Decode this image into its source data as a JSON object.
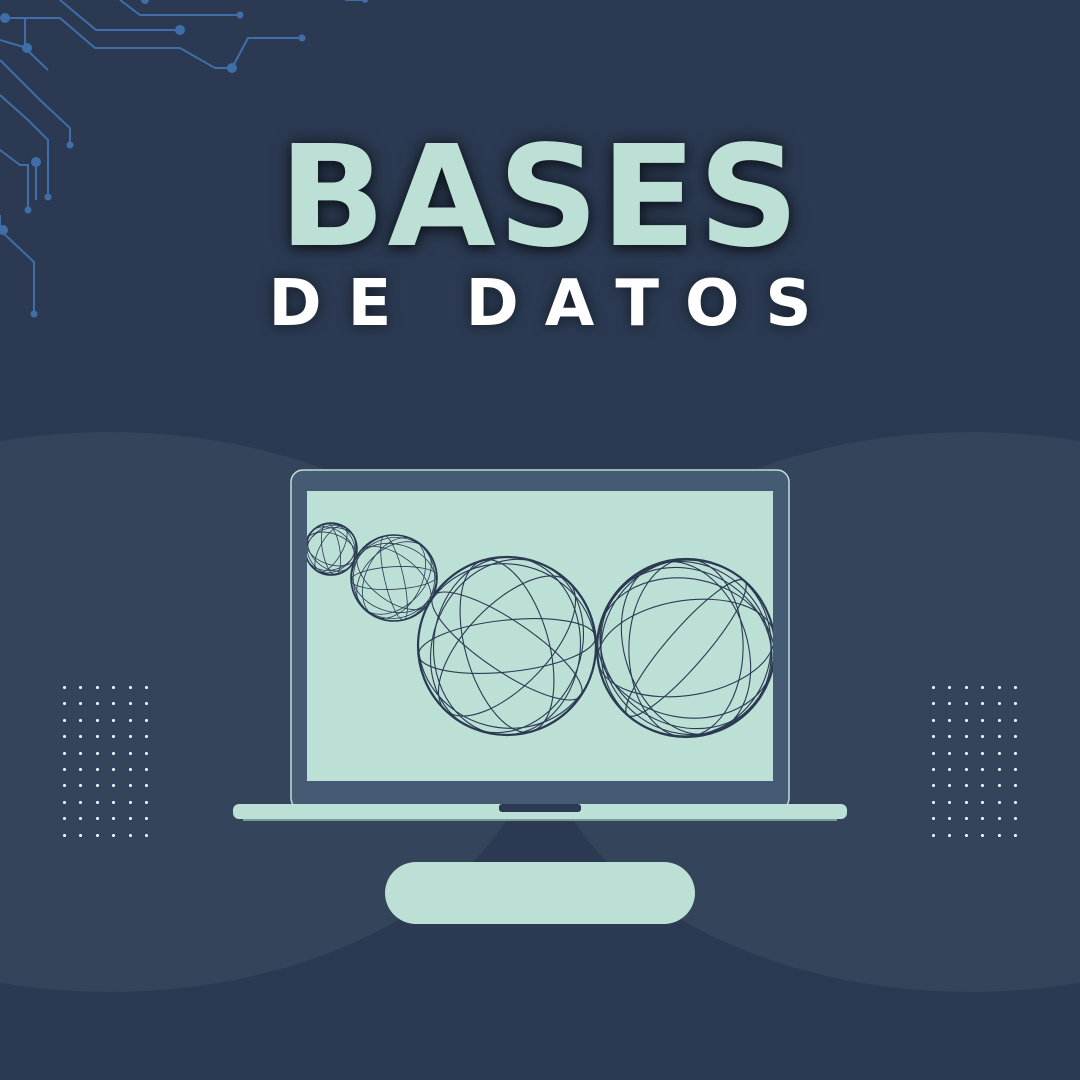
{
  "title": {
    "main": "BASES",
    "sub": "DE DATOS"
  },
  "colors": {
    "background": "#2b3a52",
    "mint": "#bce0d6",
    "circuit": "#3f6ea8",
    "bezel": "#455a73",
    "sphere_line": "#2b3a52"
  },
  "illustration": {
    "device": "laptop",
    "screen_content": "wireframe-spheres",
    "sphere_count": 4
  },
  "decorations": [
    "circuit-traces",
    "dot-grid-left",
    "dot-grid-right"
  ]
}
